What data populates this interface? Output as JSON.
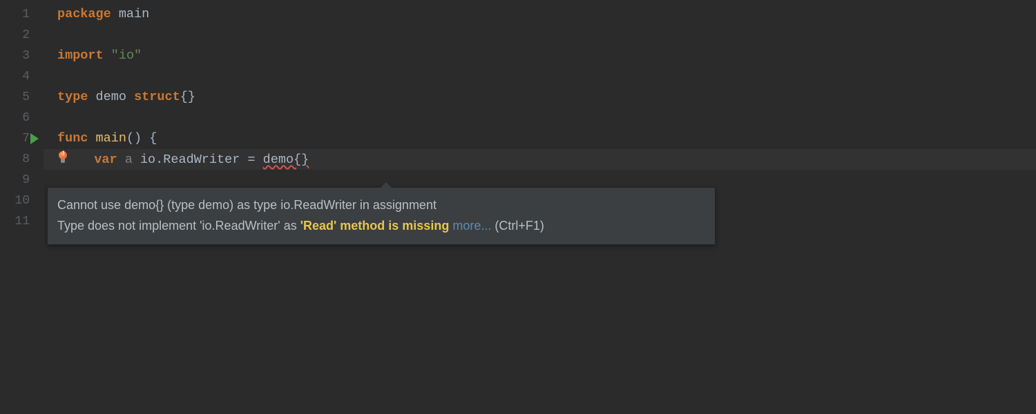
{
  "gutter": {
    "lines": [
      "1",
      "2",
      "3",
      "4",
      "5",
      "6",
      "7",
      "8",
      "9",
      "10",
      "11"
    ]
  },
  "code": {
    "line1": {
      "kw": "package",
      "sp": " ",
      "ident": "main"
    },
    "line3": {
      "kw": "import",
      "sp": " ",
      "str": "\"io\""
    },
    "line5": {
      "kw1": "type",
      "sp1": " ",
      "ident": "demo",
      "sp2": " ",
      "kw2": "struct",
      "braces": "{}"
    },
    "line7": {
      "kw": "func",
      "sp": " ",
      "name": "main",
      "parens": "()",
      "sp2": " ",
      "brace": "{"
    },
    "line8": {
      "indent": "   ",
      "kw": "var",
      "sp1": " ",
      "varname": "a",
      "sp2": " ",
      "pkg": "io",
      "dot": ".",
      "typename": "ReadWriter",
      "sp3": " ",
      "eq": "=",
      "sp4": " ",
      "errexpr": "demo{}"
    }
  },
  "tooltip": {
    "line1": "Cannot use demo{} (type demo) as type io.ReadWriter in assignment",
    "line2_pre": "Type does not implement 'io.ReadWriter' as ",
    "line2_highlight": "'Read' method is missing",
    "line2_sp": " ",
    "more_link": "more...",
    "shortcut": " (Ctrl+F1)"
  }
}
